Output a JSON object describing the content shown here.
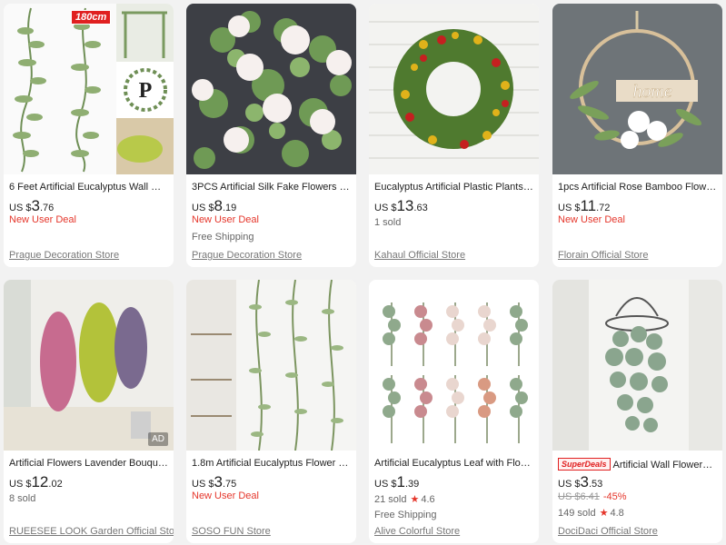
{
  "products": [
    {
      "title": "6 Feet Artificial Eucalyptus Wall Ha...",
      "price_currency": "US $",
      "price_int": "3",
      "price_dec": ".76",
      "lines": [
        "New User Deal"
      ],
      "store": "Prague Decoration Store",
      "badge": "180cm",
      "image_icon": "eucalyptus-garland-photo"
    },
    {
      "title": "3PCS Artificial Silk Fake Flowers Ga...",
      "price_currency": "US $",
      "price_int": "8",
      "price_dec": ".19",
      "lines": [
        "New User Deal",
        "Free Shipping"
      ],
      "store": "Prague Decoration Store",
      "image_icon": "rose-garland-photo"
    },
    {
      "title": "Eucalyptus Artificial Plastic Plants ...",
      "price_currency": "US $",
      "price_int": "13",
      "price_dec": ".63",
      "lines": [
        "1 sold"
      ],
      "store": "Kahaul Official Store",
      "image_icon": "flower-wreath-photo"
    },
    {
      "title": "1pcs Artificial Rose Bamboo Flowe...",
      "price_currency": "US $",
      "price_int": "11",
      "price_dec": ".72",
      "lines": [
        "New User Deal"
      ],
      "store": "Florain Official Store",
      "image_icon": "home-hoop-wreath-photo",
      "image_text": "home"
    },
    {
      "title": "Artificial Flowers Lavender Bouque...",
      "price_currency": "US $",
      "price_int": "12",
      "price_dec": ".02",
      "lines": [
        "8 sold"
      ],
      "store": "RUEESEE LOOK Garden Official Sto...",
      "ad": "AD",
      "image_icon": "hanging-lavender-photo"
    },
    {
      "title": "1.8m Artificial Eucalyptus Flower G...",
      "price_currency": "US $",
      "price_int": "3",
      "price_dec": ".75",
      "lines": [
        "New User Deal"
      ],
      "store": "SOSO FUN Store",
      "image_icon": "eucalyptus-vines-photo"
    },
    {
      "title": "Artificial Eucalyptus Leaf with Flow...",
      "price_currency": "US $",
      "price_int": "1",
      "price_dec": ".39",
      "sold": "21 sold",
      "rating": "4.6",
      "lines": [
        "Free Shipping"
      ],
      "store": "Alive Colorful Store",
      "image_icon": "eucalyptus-stems-photo"
    },
    {
      "title": "Artificial Wall Flowers Gr...",
      "superdeals": "SuperDeals",
      "price_currency": "US $",
      "price_int": "3",
      "price_dec": ".53",
      "original_price": "US $6.41",
      "discount": "-45%",
      "sold": "149 sold",
      "rating": "4.8",
      "store": "DociDaci Official Store",
      "image_icon": "hanging-eucalyptus-photo"
    }
  ],
  "colors": {
    "accent_red": "#e5362b",
    "background": "#f2f2f2",
    "card": "#ffffff"
  }
}
